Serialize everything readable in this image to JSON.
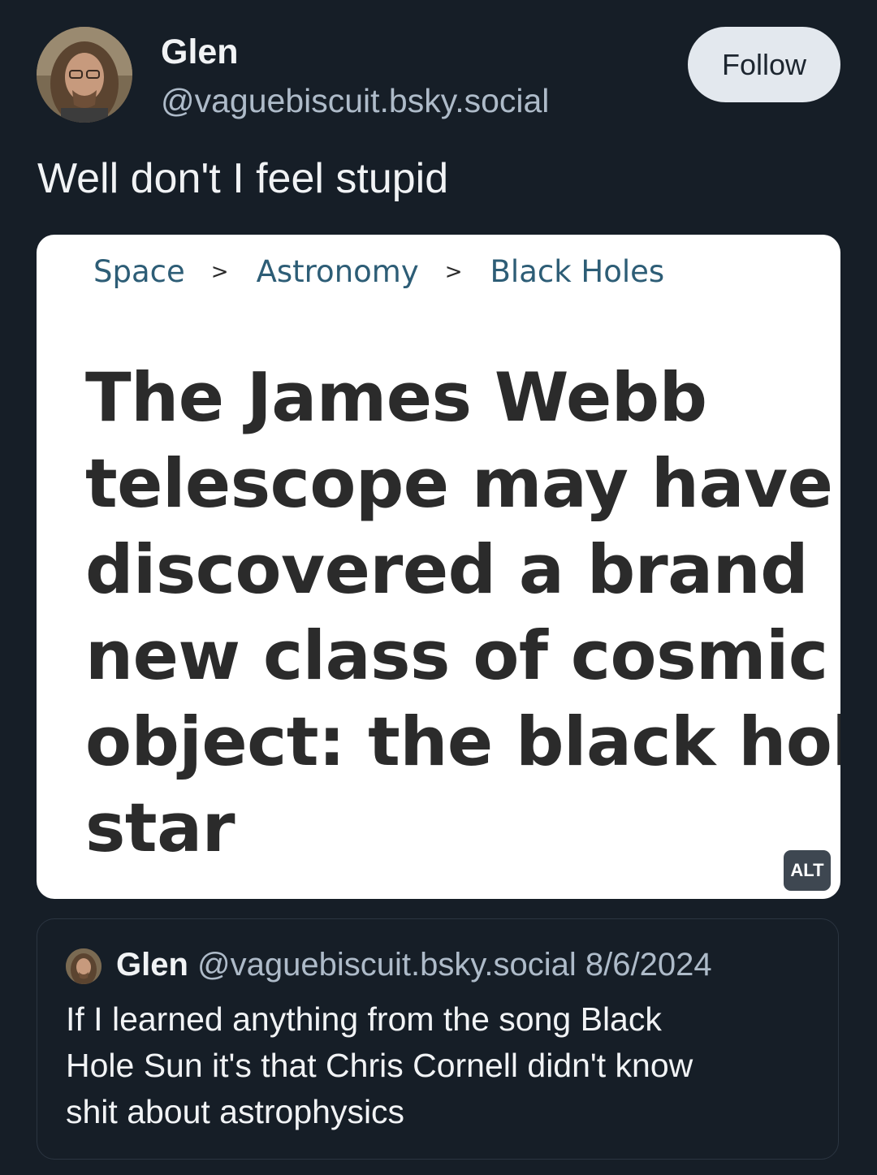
{
  "post": {
    "author": {
      "display_name": "Glen",
      "handle": "@vaguebiscuit.bsky.social",
      "avatar_icon": "user-avatar-photo"
    },
    "follow_label": "Follow",
    "text": "Well don't I feel stupid"
  },
  "embedded_image": {
    "breadcrumb": [
      "Space",
      "Astronomy",
      "Black Holes"
    ],
    "breadcrumb_separator": ">",
    "headline_lines": [
      "The James Webb",
      "telescope may have",
      "discovered a brand",
      "new class of cosmic",
      "object: the black hole",
      "star"
    ],
    "alt_label": "ALT"
  },
  "quoted_post": {
    "display_name": "Glen",
    "handle": "@vaguebiscuit.bsky.social",
    "date": "8/6/2024",
    "text_lines": [
      "If I learned anything from the song Black",
      "Hole Sun it's that Chris Cornell didn't know",
      "shit about astrophysics"
    ]
  },
  "colors": {
    "background": "#161e27",
    "primary_text": "#f1f3f5",
    "secondary_text": "#aebbc9",
    "follow_button_bg": "#e3e8ee",
    "breadcrumb_link": "#2d5d76",
    "headline_text": "#2b2b2b"
  }
}
